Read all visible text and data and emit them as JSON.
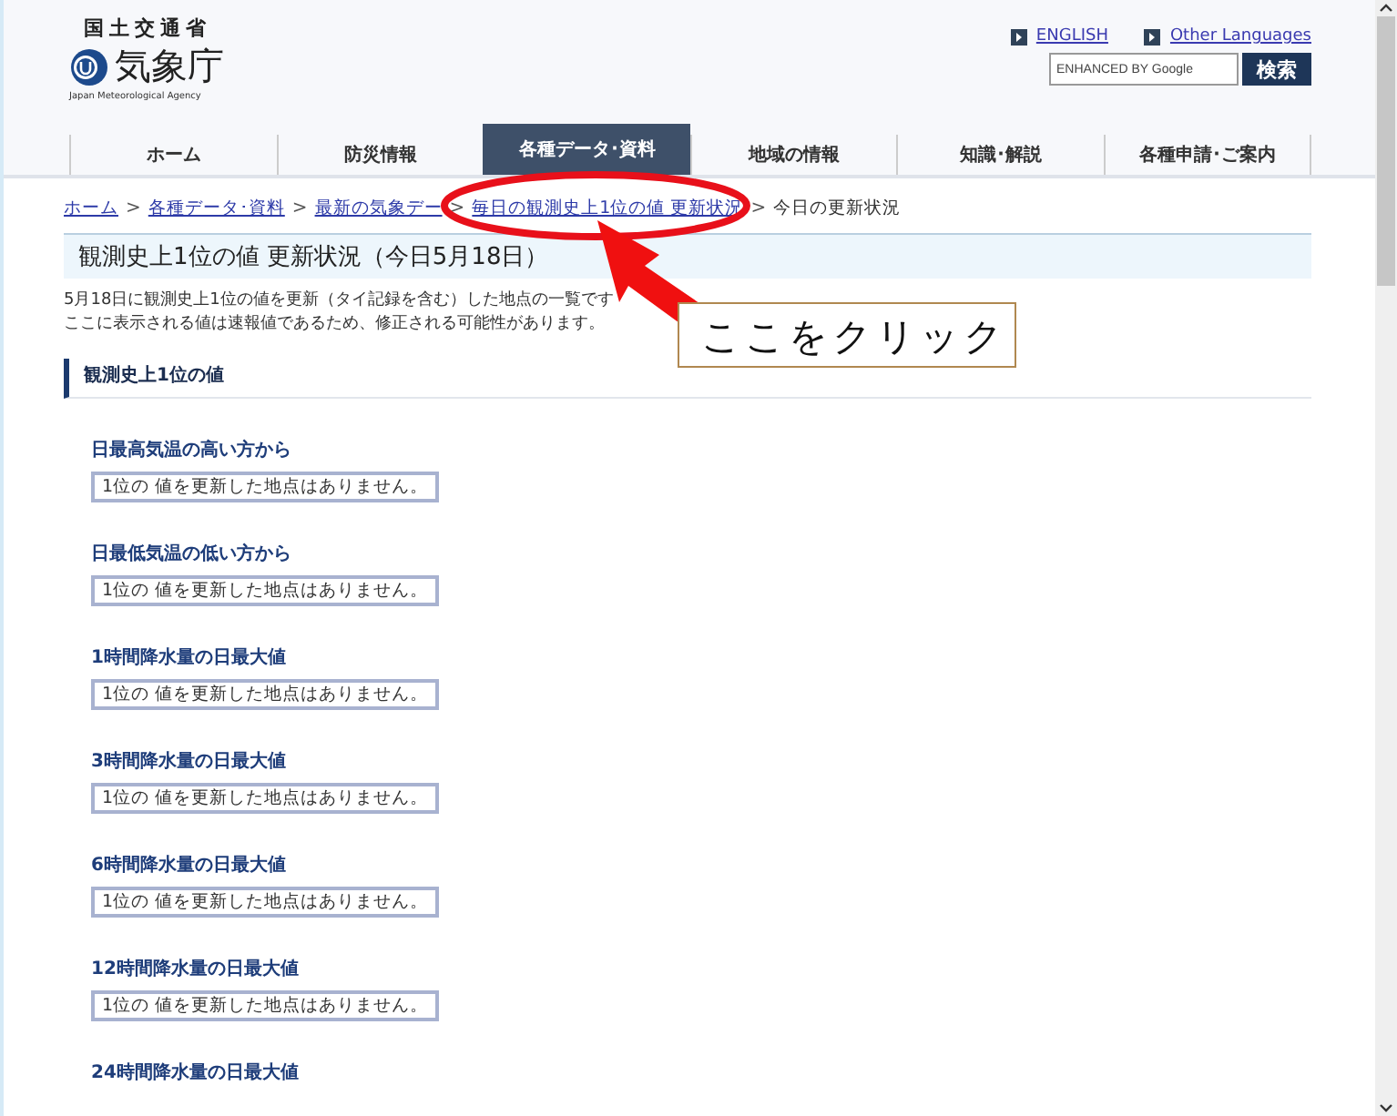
{
  "header": {
    "ministry": "国土交通省",
    "agency_name": "気象庁",
    "agency_name_en": "Japan Meteorological Agency",
    "links": [
      {
        "label": "ENGLISH"
      },
      {
        "label": "Other Languages"
      }
    ],
    "search": {
      "placeholder": "ENHANCED BY Google",
      "button": "検索"
    }
  },
  "nav": [
    {
      "label": "ホーム",
      "selected": false
    },
    {
      "label": "防災情報",
      "selected": false
    },
    {
      "label": "各種データ･資料",
      "selected": true
    },
    {
      "label": "地域の情報",
      "selected": false
    },
    {
      "label": "知識･解説",
      "selected": false
    },
    {
      "label": "各種申請･ご案内",
      "selected": false
    }
  ],
  "breadcrumb": [
    {
      "label": "ホーム",
      "link": true
    },
    {
      "separator": ">",
      "label": "各種データ･資料",
      "link": true
    },
    {
      "separator": ">",
      "label": "最新の気象デー",
      "link": true
    },
    {
      "separator": ">",
      "label": "毎日の観測史上1位の値 更新状況",
      "link": true
    },
    {
      "separator": ">",
      "label": "今日の更新状況",
      "link": false
    }
  ],
  "page_title": "観測史上1位の値 更新状況（今日5月18日）",
  "intro": [
    "5月18日に観測史上1位の値を更新（タイ記録を含む）した地点の一覧です",
    "ここに表示される値は速報値であるため、修正される可能性があります。"
  ],
  "section_title": "観測史上1位の値",
  "records": [
    {
      "title": "日最高気温の高い方から",
      "message": "1位の 値を更新した地点はありません。"
    },
    {
      "title": "日最低気温の低い方から",
      "message": "1位の 値を更新した地点はありません。"
    },
    {
      "title": "1時間降水量の日最大値",
      "message": "1位の 値を更新した地点はありません。"
    },
    {
      "title": "3時間降水量の日最大値",
      "message": "1位の 値を更新した地点はありません。"
    },
    {
      "title": "6時間降水量の日最大値",
      "message": "1位の 値を更新した地点はありません。"
    },
    {
      "title": "12時間降水量の日最大値",
      "message": "1位の 値を更新した地点はありません。"
    },
    {
      "title": "24時間降水量の日最大値"
    }
  ],
  "annotation": {
    "callout": "ここをクリック"
  }
}
